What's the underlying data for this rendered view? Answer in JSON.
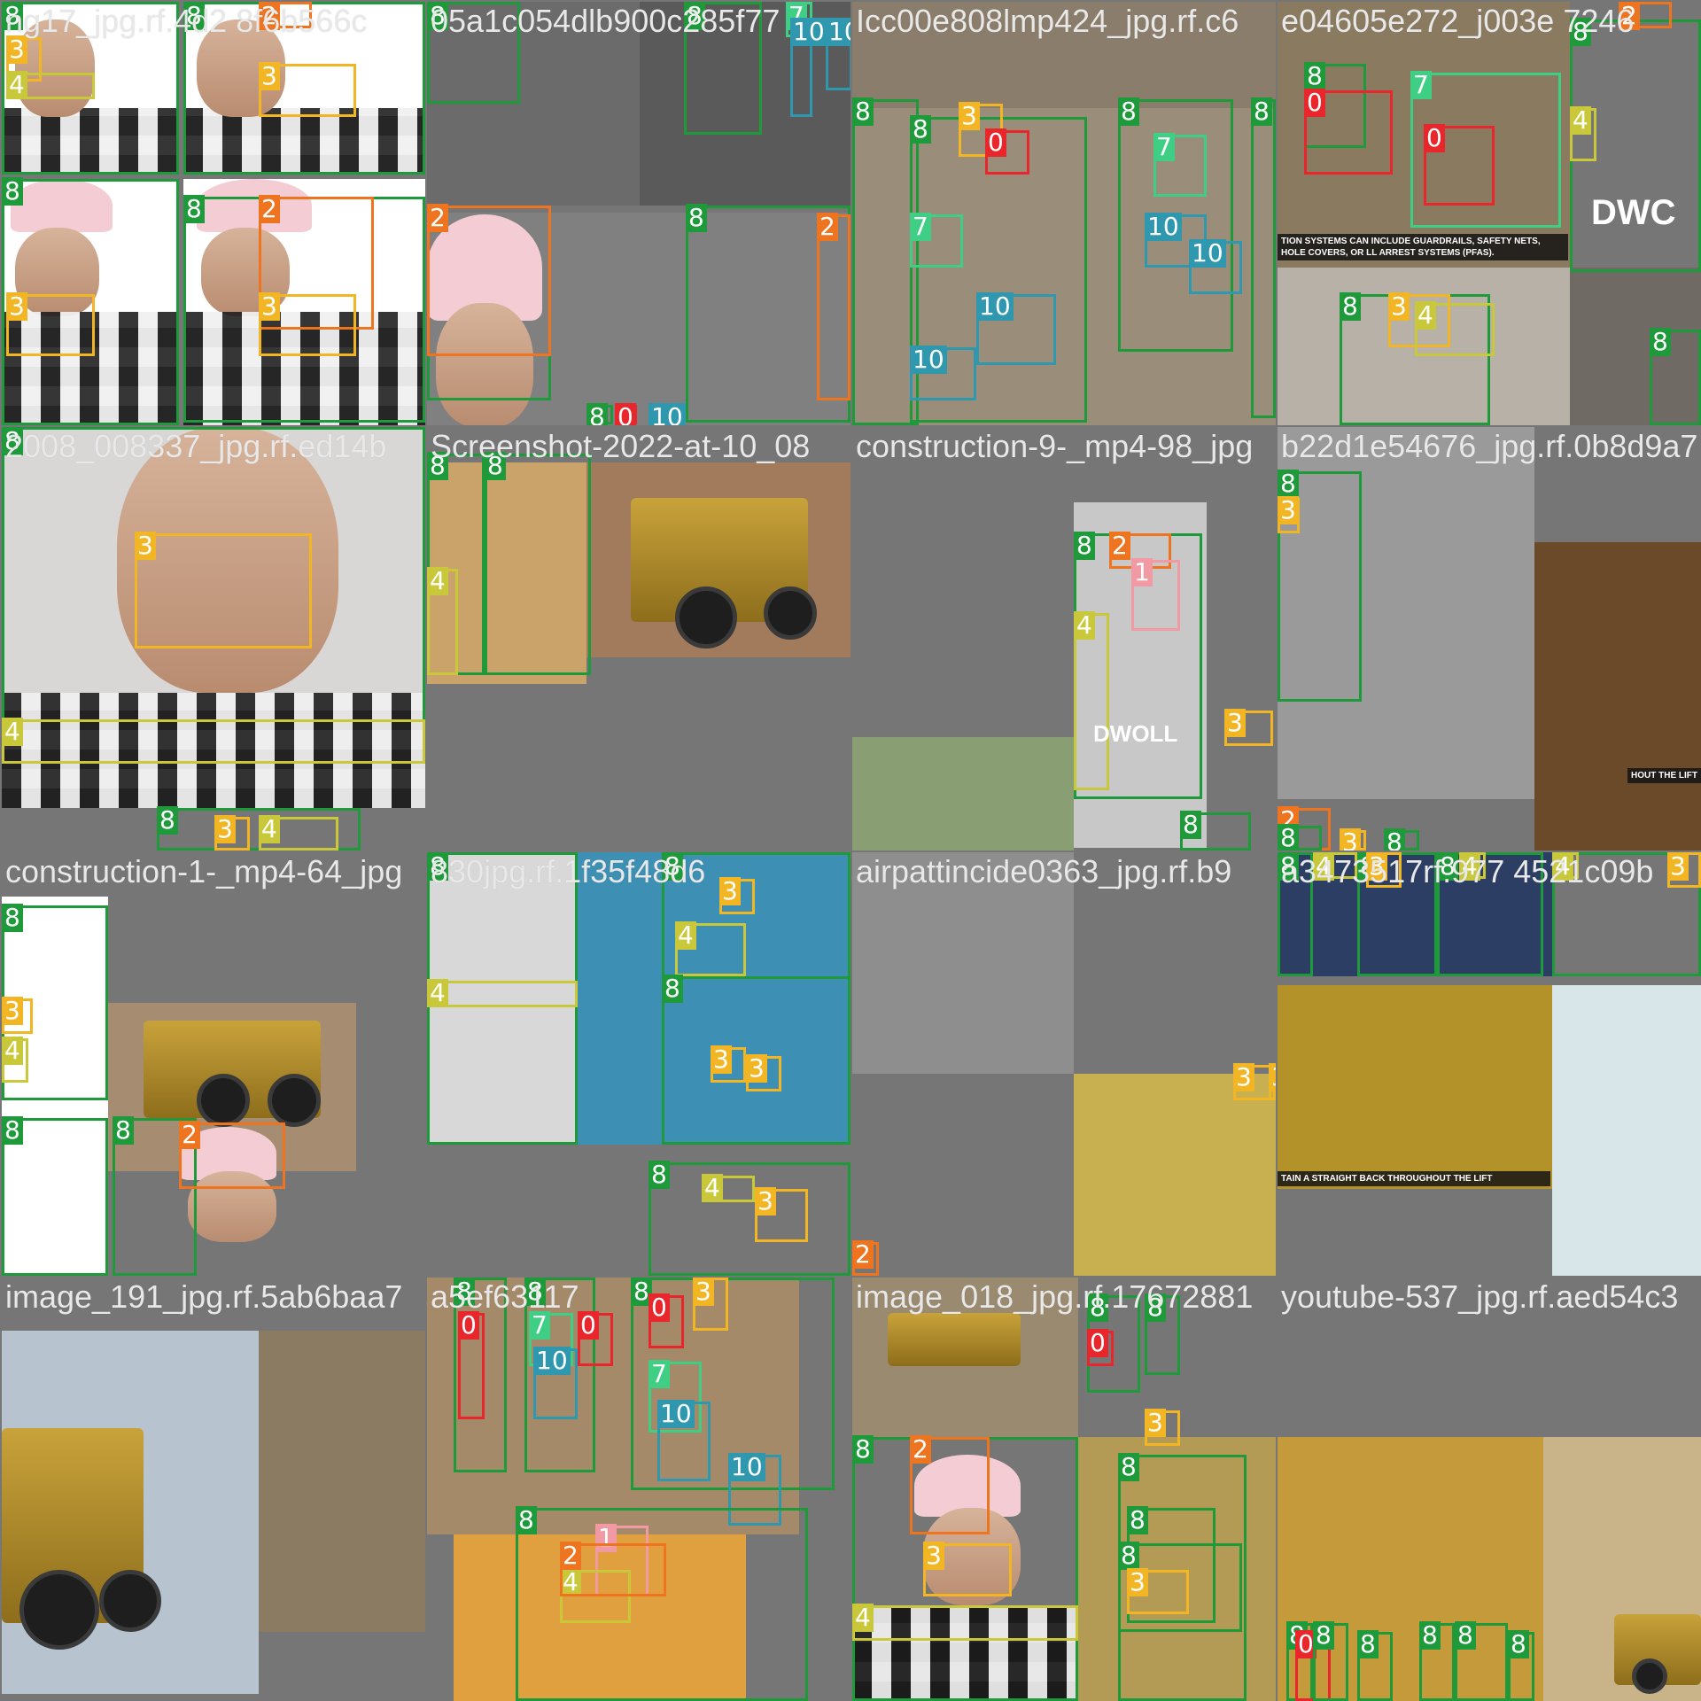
{
  "mosaic": {
    "tiles": [
      {
        "filename": "ng17_jpg.rf.4d2 8f6b566c",
        "region_colors": [
          "#ffffff",
          "#ffffff",
          "#ffffff",
          "#ffffff"
        ]
      },
      {
        "filename": "05a1c054dlb900c285f77 ",
        "region_colors": [
          "#6b6b6b",
          "#5a5a5a",
          "#808080"
        ]
      },
      {
        "filename": "Icc00e808lmp424_jpg.rf.c6",
        "region_colors": [
          "#9a8e7a",
          "#8b7d6b"
        ]
      },
      {
        "filename": "e04605e272_j003e 7246",
        "region_colors": [
          "#8a7a60",
          "#b7b1a8",
          "#6f6a64"
        ]
      },
      {
        "filename": "2008_008337_jpg.rf.ed14b",
        "region_colors": [
          "#d9d7d6"
        ]
      },
      {
        "filename": "Screenshot-2022-at-10_08",
        "region_colors": [
          "#caa36a",
          "#a27b5d"
        ]
      },
      {
        "filename": "construction-9-_mp4-98_jpg",
        "region_colors": [
          "#c8c8c8",
          "#8a9e74"
        ]
      },
      {
        "filename": "b22d1e54676_jpg.rf.0b8d9a7",
        "region_colors": [
          "#9a9a9a",
          "#6b4a2a"
        ]
      },
      {
        "filename": "construction-1-_mp4-64_jpg",
        "region_colors": [
          "#ffffff",
          "#a68d72"
        ]
      },
      {
        "filename": "830jpg.rf.1f35f48d6",
        "region_colors": [
          "#d8d8d8",
          "#3d8fb3"
        ]
      },
      {
        "filename": "airpattincide0363_jpg.rf.b9",
        "region_colors": [
          "#8e8e8e",
          "#c8b050"
        ]
      },
      {
        "filename": "a3473517rf.977 4521c09b",
        "region_colors": [
          "#2c3e63",
          "#b4922a",
          "#d8e6ea"
        ]
      },
      {
        "filename": "image_191_jpg.rf.5ab6baa7",
        "region_colors": [
          "#b7c4cf",
          "#8a7b62"
        ]
      },
      {
        "filename": "a5ef63117",
        "region_colors": [
          "#a58a6a",
          "#e0a040"
        ]
      },
      {
        "filename": "image_018_jpg.rf.17672881",
        "region_colors": [
          "#9a8a70",
          "#b49b55"
        ]
      },
      {
        "filename": "youtube-537_jpg.rf.aed54c3",
        "region_colors": [
          "#c49a3a",
          "#c9b48a"
        ]
      }
    ],
    "class_colors": {
      "0": "#e8262c",
      "1": "#f29aa4",
      "2": "#ef7420",
      "3": "#f2b624",
      "4": "#c8c83a",
      "7": "#3ecf84",
      "8": "#1f9a3a",
      "10": "#2f98ae"
    },
    "labels": {
      "c0": "0",
      "c1": "1",
      "c2": "2",
      "c3": "3",
      "c4": "4",
      "c7": "7",
      "c8": "8",
      "c10": "10"
    },
    "signs": {
      "fall_protection": "TION SYSTEMS CAN INCLUDE GUARDRAILS, SAFETY NETS, HOLE COVERS, OR LL ARREST SYSTEMS (PFAS).",
      "lift_back": "TAIN A STRAIGHT BACK THROUGHOUT THE LIFT",
      "lift_short": "HOUT THE LIFT",
      "dwoll": "DWOLL",
      "dwo": "DWC"
    }
  }
}
